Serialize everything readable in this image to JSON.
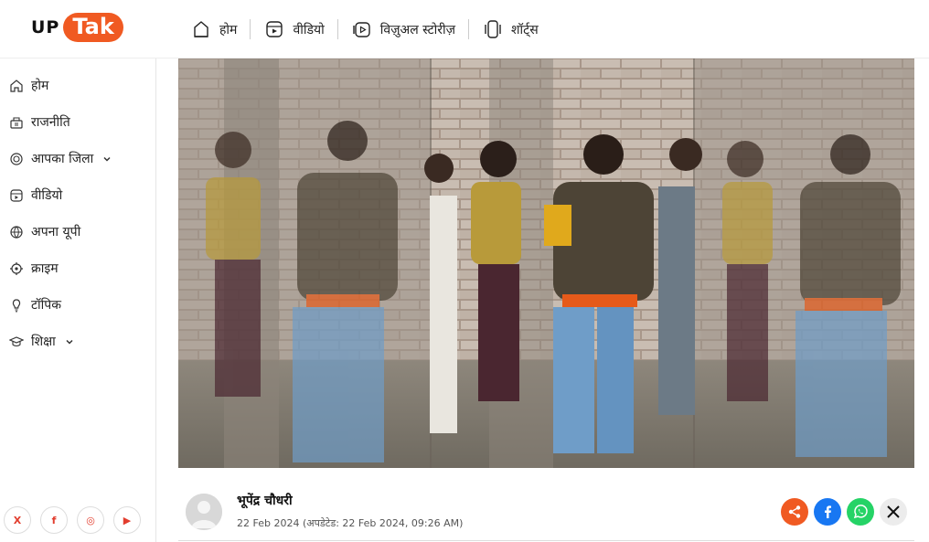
{
  "logo": {
    "up": "UP",
    "tak": "Tak"
  },
  "topnav": [
    {
      "label": "होम",
      "icon": "home-outline-icon"
    },
    {
      "label": "वीडियो",
      "icon": "video-play-icon"
    },
    {
      "label": "विज़ुअल स्टोरीज़",
      "icon": "stories-play-icon"
    },
    {
      "label": "शॉर्ट्स",
      "icon": "shorts-icon"
    }
  ],
  "sidebar": {
    "items": [
      {
        "label": "होम",
        "icon": "home-icon",
        "has_chevron": false
      },
      {
        "label": "राजनीति",
        "icon": "politics-icon",
        "has_chevron": false
      },
      {
        "label": "आपका जिला",
        "icon": "district-icon",
        "has_chevron": true
      },
      {
        "label": "वीडियो",
        "icon": "video-icon",
        "has_chevron": false
      },
      {
        "label": "अपना यूपी",
        "icon": "globe-icon",
        "has_chevron": false
      },
      {
        "label": "क्राइम",
        "icon": "crime-target-icon",
        "has_chevron": false
      },
      {
        "label": "टॉपिक",
        "icon": "bulb-icon",
        "has_chevron": false
      },
      {
        "label": "शिक्षा",
        "icon": "education-cap-icon",
        "has_chevron": true
      }
    ],
    "socials": [
      {
        "label": "X",
        "icon": "x-icon"
      },
      {
        "label": "f",
        "icon": "facebook-icon"
      },
      {
        "label": "◎",
        "icon": "instagram-icon"
      },
      {
        "label": "▶",
        "icon": "youtube-icon"
      }
    ]
  },
  "article": {
    "author": "भूपेंद्र चौधरी",
    "date": "22 Feb 2024 (अपडेटेड: 22 Feb 2024, 09:26 AM)"
  },
  "share_buttons": [
    {
      "name": "share",
      "icon": "share-icon",
      "color": "#f05a22"
    },
    {
      "name": "facebook",
      "icon": "facebook-icon",
      "color": "#1877f2"
    },
    {
      "name": "whatsapp",
      "icon": "whatsapp-icon",
      "color": "#25d366"
    },
    {
      "name": "x",
      "icon": "x-icon",
      "color": "#e9e9e9"
    }
  ],
  "colors": {
    "brand": "#f05a22"
  }
}
